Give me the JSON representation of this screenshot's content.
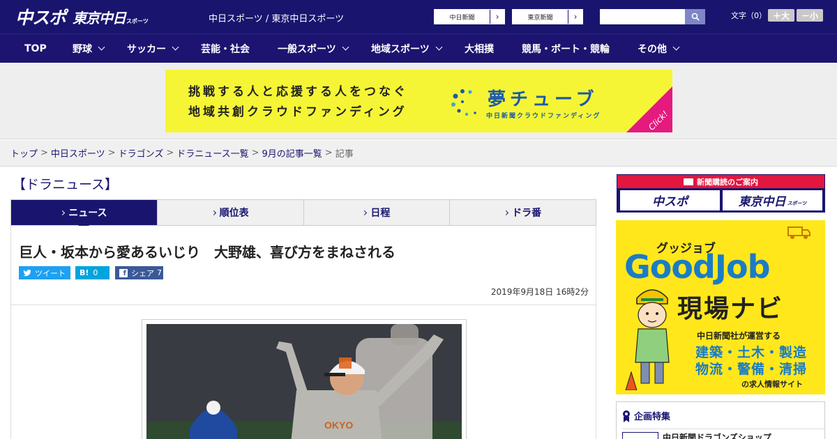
{
  "header": {
    "logo_main": "中スポ",
    "logo_sub": "東京中日",
    "logo_sub_small": "スポーツ",
    "site_names": "中日スポーツ / 東京中日スポーツ",
    "link_chunichi": "中日新聞",
    "link_tokyo": "東京新聞",
    "search_placeholder": "",
    "fontsize_label": "文字（0）",
    "fontsize_large": "＋大",
    "fontsize_small": "－小"
  },
  "nav": {
    "items": [
      {
        "label": "TOP",
        "has_dropdown": false
      },
      {
        "label": "野球",
        "has_dropdown": true
      },
      {
        "label": "サッカー",
        "has_dropdown": true
      },
      {
        "label": "芸能・社会",
        "has_dropdown": false
      },
      {
        "label": "一般スポーツ",
        "has_dropdown": true
      },
      {
        "label": "地域スポーツ",
        "has_dropdown": true
      },
      {
        "label": "大相撲",
        "has_dropdown": false
      },
      {
        "label": "競馬・ボート・競輪",
        "has_dropdown": false
      },
      {
        "label": "その他",
        "has_dropdown": true
      }
    ]
  },
  "banner": {
    "line1": "挑戦する人と応援する人をつなぐ",
    "line2": "地域共創クラウドファンディング",
    "brand": "夢チューブ",
    "brand_sub": "中日新聞クラウドファンディング",
    "click": "Click!"
  },
  "breadcrumb": {
    "items": [
      "トップ",
      "中日スポーツ",
      "ドラゴンズ",
      "ドラニュース一覧",
      "9月の記事一覧"
    ],
    "separator": ">",
    "current": "記事"
  },
  "main": {
    "section_title": "【ドラニュース】",
    "tabs": [
      {
        "label": "ニュース",
        "active": true
      },
      {
        "label": "順位表",
        "active": false
      },
      {
        "label": "日程",
        "active": false
      },
      {
        "label": "ドラ番",
        "active": false
      }
    ],
    "headline": "巨人・坂本から愛あるいじり　大野雄、喜び方をまねされる",
    "share": {
      "tweet": "ツイート",
      "hatena_icon": "B!",
      "hatena_count": "0",
      "facebook": "シェア",
      "facebook_count": "7"
    },
    "pubdate": "2019年9月18日 16時2分"
  },
  "sidebar": {
    "subscribe_head": "新聞購読のご案内",
    "subscribe_chusupo": "中スポ",
    "subscribe_tokyo": "東京中日",
    "subscribe_tokyo_small": "スポーツ",
    "goodjob_kana": "グッジョブ",
    "goodjob_title": "GoodJob",
    "goodjob_navi": "現場ナビ",
    "goodjob_line1": "中日新聞社が運営する",
    "goodjob_line2": "建築・土木・製造",
    "goodjob_line3": "物流・警備・清掃",
    "goodjob_line4": "の求人情報サイト",
    "special_head": "企画特集",
    "special_item": "中日新聞ドラゴンズショップ"
  },
  "colors": {
    "brand_navy": "#19156f",
    "banner_yellow": "#f5f536",
    "banner_blue": "#1d5aa8",
    "click_pink": "#e51a7e",
    "subscribe_red": "#e2163e",
    "goodjob_yellow": "#ffe71c",
    "goodjob_blue": "#1a7cc6",
    "twitter_blue": "#1da1f2",
    "hatena_blue": "#00a4de",
    "facebook_blue": "#3b5998"
  }
}
